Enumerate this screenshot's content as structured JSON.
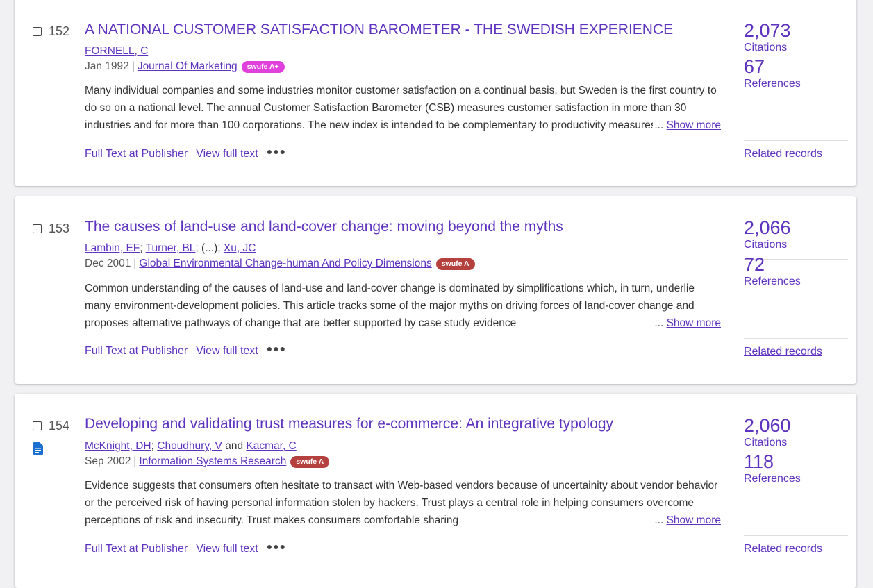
{
  "records": [
    {
      "number": "152",
      "title": "A NATIONAL CUSTOMER SATISFACTION BAROMETER - THE SWEDISH EXPERIENCE",
      "authors": [
        {
          "name": "FORNELL, C"
        }
      ],
      "date": "Jan 1992",
      "journal": "Journal Of Marketing",
      "badge": {
        "label": "swufe A+",
        "color": "#e040dc"
      },
      "abstract": "Many individual companies and some industries monitor customer satisfaction on a continual basis, but Sweden is the first country to do so on a national level. The annual Customer Satisfaction Barometer (CSB) measures customer satisfaction in more than 30 industries and for more than 100 corporations. The new index is intended to be complementary to productivity measures",
      "show_more": "Show more",
      "ellipsis": "...",
      "full_text_publisher": "Full Text at Publisher",
      "view_full_text": "View full text",
      "more_icon": "more-options-icon",
      "citations_count": "2,073",
      "citations_label": "Citations",
      "references_count": "67",
      "references_label": "References",
      "related_records": "Related records"
    },
    {
      "number": "153",
      "title": "The causes of land-use and land-cover change: moving beyond the myths",
      "authors": [
        {
          "name": "Lambin, EF"
        },
        {
          "name": "Turner, BL"
        },
        {
          "name": "Xu, JC"
        }
      ],
      "authors_sep": ";",
      "authors_ellipsis": "(...);",
      "date": "Dec 2001",
      "journal": "Global Environmental Change-human And Policy Dimensions",
      "badge": {
        "label": "swufe A",
        "color": "#b5413f"
      },
      "abstract": "Common understanding of the causes of land-use and land-cover change is dominated by simplifications which, in turn, underlie many environment-development policies. This article tracks some of the major myths on driving forces of land-cover change and proposes alternative pathways of change that are better supported by case study evidence",
      "show_more": "Show more",
      "ellipsis": "...",
      "full_text_publisher": "Full Text at Publisher",
      "view_full_text": "View full text",
      "more_icon": "more-options-icon",
      "citations_count": "2,066",
      "citations_label": "Citations",
      "references_count": "72",
      "references_label": "References",
      "related_records": "Related records"
    },
    {
      "number": "154",
      "title": "Developing and validating trust measures for e-commerce: An integrative typology",
      "authors": [
        {
          "name": "McKnight, DH"
        },
        {
          "name": "Choudhury, V"
        },
        {
          "name": "Kacmar, C"
        }
      ],
      "authors_and": "and",
      "date": "Sep 2002",
      "journal": "Information Systems Research",
      "badge": {
        "label": "swufe A",
        "color": "#b5413f"
      },
      "abstract": "Evidence suggests that consumers often hesitate to transact with Web-based vendors because of uncertainity about vendor behavior or the perceived risk of having personal information stolen by hackers. Trust plays a central role in helping consumers overcome perceptions of risk and insecurity. Trust makes consumers comfortable sharing",
      "show_more": "Show more",
      "ellipsis": "...",
      "full_text_publisher": "Full Text at Publisher",
      "view_full_text": "View full text",
      "more_icon": "more-options-icon",
      "doc_icon": "document-icon",
      "citations_count": "2,060",
      "citations_label": "Citations",
      "references_count": "118",
      "references_label": "References",
      "related_records": "Related records"
    }
  ],
  "colors": {
    "link": "#5e33bf",
    "doc_icon": "#1a6fd0"
  }
}
